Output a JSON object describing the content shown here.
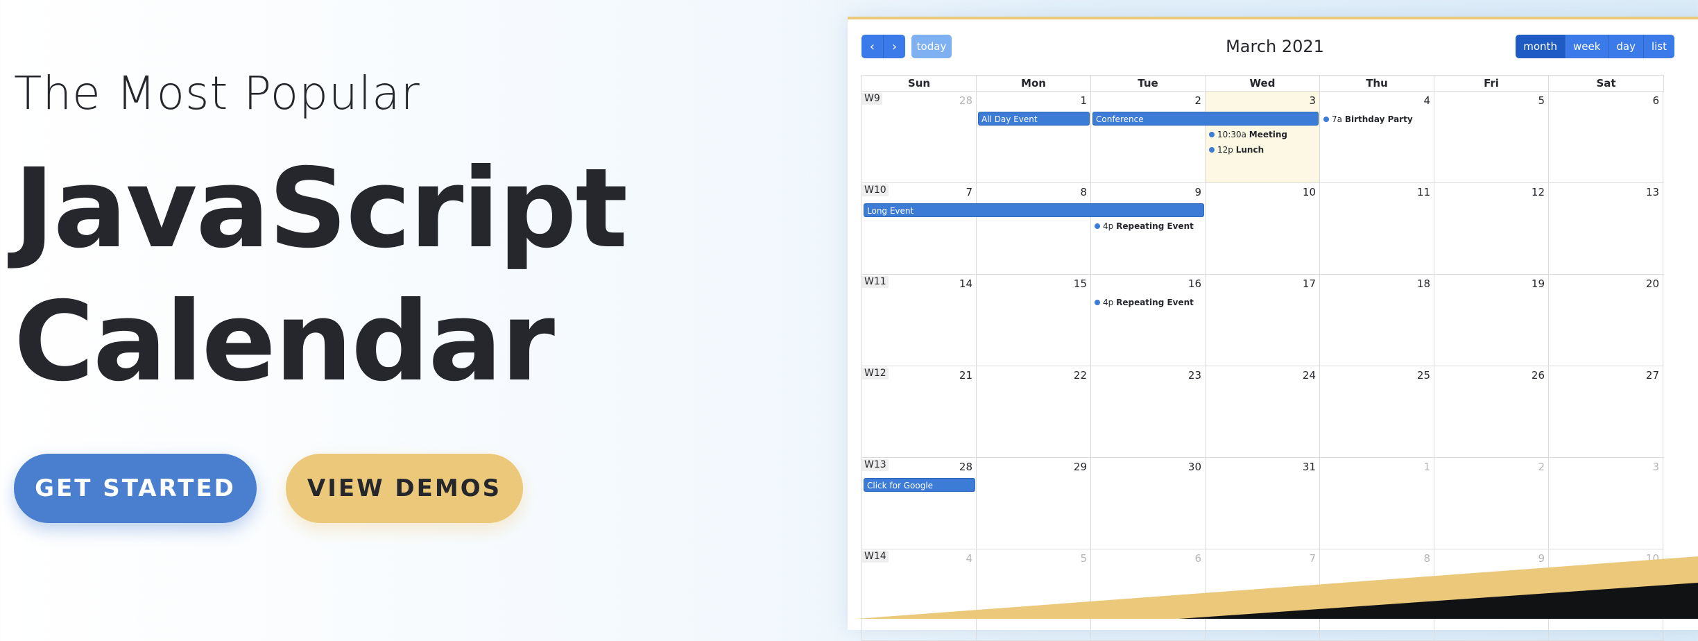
{
  "hero": {
    "subtitle": "The Most Popular",
    "title_line1": "JavaScript",
    "title_line2": "Calendar",
    "get_started": "GET STARTED",
    "view_demos": "VIEW DEMOS"
  },
  "calendar": {
    "title": "March 2021",
    "prev_icon": "‹",
    "next_icon": "›",
    "today_label": "today",
    "views": [
      "month",
      "week",
      "day",
      "list"
    ],
    "active_view": "month",
    "days_of_week": [
      "Sun",
      "Mon",
      "Tue",
      "Wed",
      "Thu",
      "Fri",
      "Sat"
    ],
    "weeks": [
      {
        "label": "W9",
        "days": [
          "28",
          "1",
          "2",
          "3",
          "4",
          "5",
          "6"
        ]
      },
      {
        "label": "W10",
        "days": [
          "7",
          "8",
          "9",
          "10",
          "11",
          "12",
          "13"
        ]
      },
      {
        "label": "W11",
        "days": [
          "14",
          "15",
          "16",
          "17",
          "18",
          "19",
          "20"
        ]
      },
      {
        "label": "W12",
        "days": [
          "21",
          "22",
          "23",
          "24",
          "25",
          "26",
          "27"
        ]
      },
      {
        "label": "W13",
        "days": [
          "28",
          "29",
          "30",
          "31",
          "1",
          "2",
          "3"
        ]
      },
      {
        "label": "W14",
        "days": [
          "4",
          "5",
          "6",
          "7",
          "8",
          "9",
          "10"
        ]
      }
    ],
    "events": {
      "all_day_event": "All Day Event",
      "conference": "Conference",
      "meeting_time": "10:30a",
      "meeting": "Meeting",
      "lunch_time": "12p",
      "lunch": "Lunch",
      "birthday_time": "7a",
      "birthday": "Birthday Party",
      "long_event": "Long Event",
      "repeating1_time": "4p",
      "repeating1": "Repeating Event",
      "repeating2_time": "4p",
      "repeating2": "Repeating Event",
      "google": "Click for Google"
    }
  },
  "colors": {
    "primary": "#3b7be9",
    "event": "#3c7bd6",
    "accent_gold": "#ebc87a",
    "today_bg": "#fcf8e3",
    "text_dark": "#25272c"
  }
}
